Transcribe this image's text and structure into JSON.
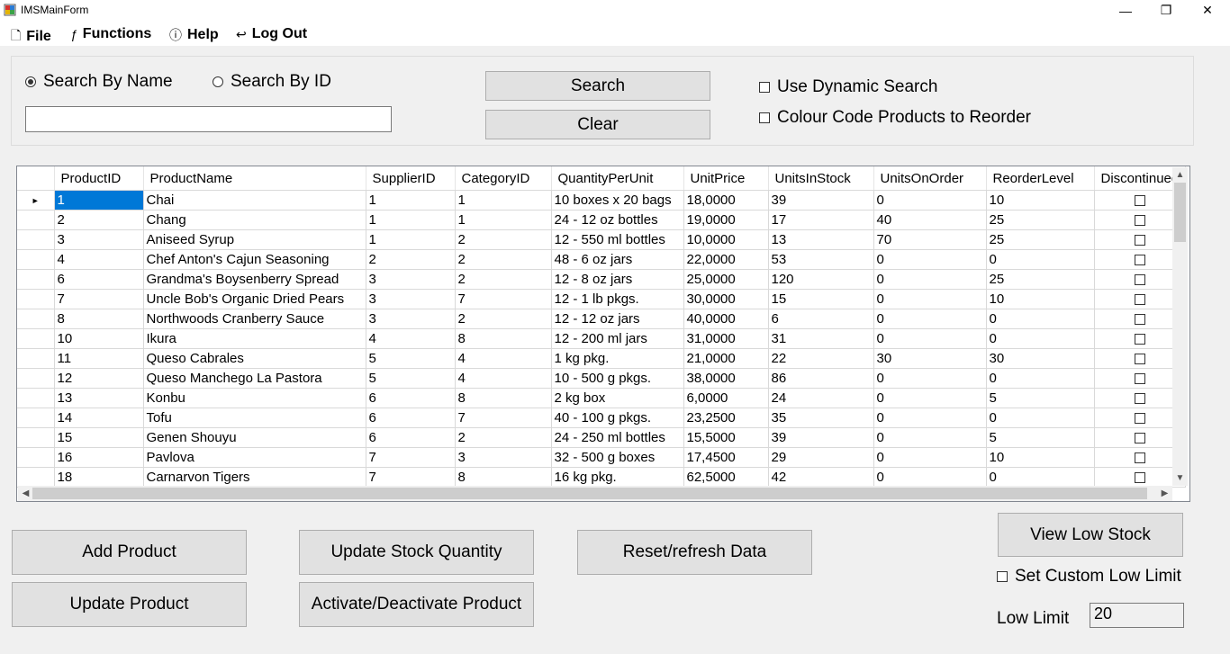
{
  "window": {
    "title": "IMSMainForm",
    "minimize": "—",
    "maximize": "❐",
    "close": "✕"
  },
  "menu": {
    "file": {
      "label": "File",
      "icon": "🗋"
    },
    "functions": {
      "label": "Functions",
      "icon": "ƒ"
    },
    "help": {
      "label": "Help",
      "icon": "ⓘ"
    },
    "logout": {
      "label": "Log Out",
      "icon": "↩"
    }
  },
  "search": {
    "by_name_label": "Search By Name",
    "by_id_label": "Search By ID",
    "selected": "name",
    "input_value": "",
    "search_button": "Search",
    "clear_button": "Clear",
    "dynamic_search_label": "Use Dynamic Search",
    "colour_code_label": "Colour Code Products to Reorder"
  },
  "grid": {
    "columns": [
      "ProductID",
      "ProductName",
      "SupplierID",
      "CategoryID",
      "QuantityPerUnit",
      "UnitPrice",
      "UnitsInStock",
      "UnitsOnOrder",
      "ReorderLevel",
      "Discontinued"
    ],
    "rows": [
      [
        "1",
        "Chai",
        "1",
        "1",
        "10 boxes x 20 bags",
        "18,0000",
        "39",
        "0",
        "10"
      ],
      [
        "2",
        "Chang",
        "1",
        "1",
        "24 - 12 oz bottles",
        "19,0000",
        "17",
        "40",
        "25"
      ],
      [
        "3",
        "Aniseed Syrup",
        "1",
        "2",
        "12 - 550 ml bottles",
        "10,0000",
        "13",
        "70",
        "25"
      ],
      [
        "4",
        "Chef Anton's Cajun Seasoning",
        "2",
        "2",
        "48 - 6 oz jars",
        "22,0000",
        "53",
        "0",
        "0"
      ],
      [
        "6",
        "Grandma's Boysenberry Spread",
        "3",
        "2",
        "12 - 8 oz jars",
        "25,0000",
        "120",
        "0",
        "25"
      ],
      [
        "7",
        "Uncle Bob's Organic Dried Pears",
        "3",
        "7",
        "12 - 1 lb pkgs.",
        "30,0000",
        "15",
        "0",
        "10"
      ],
      [
        "8",
        "Northwoods Cranberry Sauce",
        "3",
        "2",
        "12 - 12 oz jars",
        "40,0000",
        "6",
        "0",
        "0"
      ],
      [
        "10",
        "Ikura",
        "4",
        "8",
        "12 - 200 ml jars",
        "31,0000",
        "31",
        "0",
        "0"
      ],
      [
        "11",
        "Queso Cabrales",
        "5",
        "4",
        "1 kg pkg.",
        "21,0000",
        "22",
        "30",
        "30"
      ],
      [
        "12",
        "Queso Manchego La Pastora",
        "5",
        "4",
        "10 - 500 g pkgs.",
        "38,0000",
        "86",
        "0",
        "0"
      ],
      [
        "13",
        "Konbu",
        "6",
        "8",
        "2 kg box",
        "6,0000",
        "24",
        "0",
        "5"
      ],
      [
        "14",
        "Tofu",
        "6",
        "7",
        "40 - 100 g pkgs.",
        "23,2500",
        "35",
        "0",
        "0"
      ],
      [
        "15",
        "Genen Shouyu",
        "6",
        "2",
        "24 - 250 ml bottles",
        "15,5000",
        "39",
        "0",
        "5"
      ],
      [
        "16",
        "Pavlova",
        "7",
        "3",
        "32 - 500 g boxes",
        "17,4500",
        "29",
        "0",
        "10"
      ],
      [
        "18",
        "Carnarvon Tigers",
        "7",
        "8",
        "16 kg pkg.",
        "62,5000",
        "42",
        "0",
        "0"
      ]
    ],
    "row_indicator": "►",
    "selected_accent": "#0078d7"
  },
  "actions": {
    "add_product": "Add Product",
    "update_product": "Update Product",
    "update_stock": "Update Stock Quantity",
    "activate_deactivate": "Activate/Deactivate Product",
    "reset_refresh": "Reset/refresh Data",
    "view_low_stock": "View Low Stock",
    "custom_low_limit_label": "Set Custom Low Limit",
    "low_limit_label": "Low Limit",
    "low_limit_value": "20"
  }
}
